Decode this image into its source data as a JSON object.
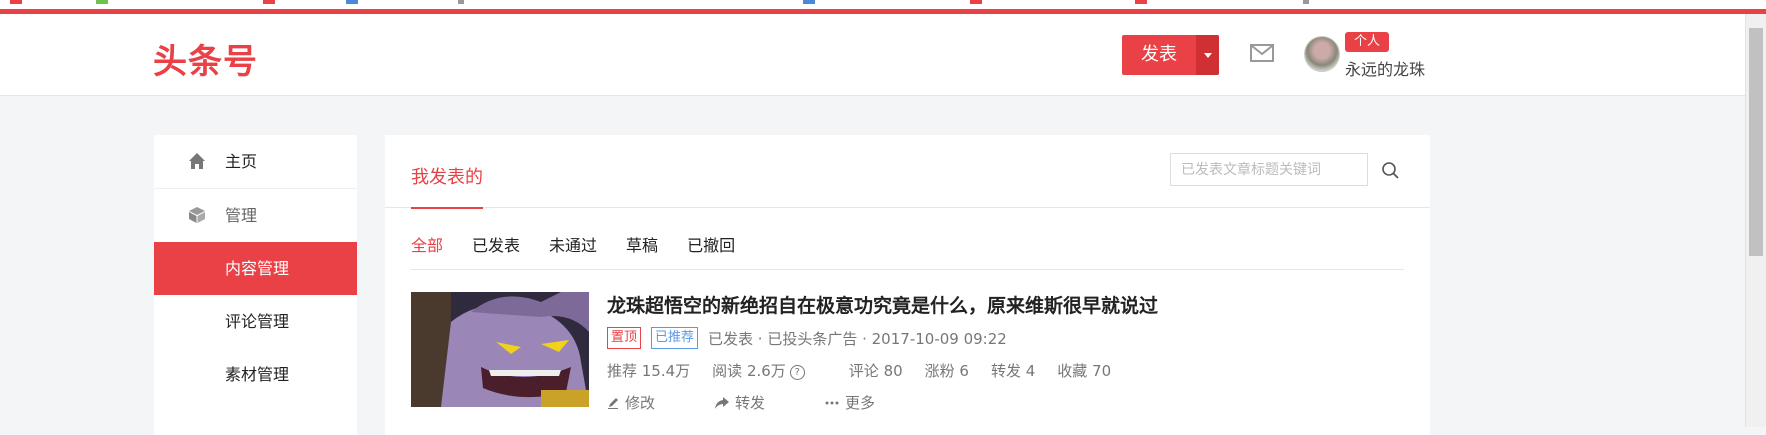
{
  "header": {
    "logo_text": "头条号",
    "publish_label": "发表",
    "badge_text": "个人",
    "username": "永远的龙珠"
  },
  "sidebar": {
    "items": [
      {
        "label": "主页",
        "icon": "home-icon"
      },
      {
        "label": "管理",
        "icon": "cube-icon"
      },
      {
        "label": "内容管理",
        "active": true
      },
      {
        "label": "评论管理"
      },
      {
        "label": "素材管理"
      }
    ]
  },
  "main": {
    "tab_label": "我发表的",
    "search_placeholder": "已发表文章标题关键词",
    "filters": [
      "全部",
      "已发表",
      "未通过",
      "草稿",
      "已撤回"
    ],
    "article": {
      "title": "龙珠超悟空的新绝招自在极意功究竟是什么，原来维斯很早就说过",
      "tag_pinned": "置顶",
      "tag_recommended": "已推荐",
      "status": "已发表 · 已投头条广告 · 2017-10-09 09:22",
      "stats": {
        "recommend": "推荐 15.4万",
        "read": "阅读 2.6万",
        "comment": "评论 80",
        "fans": "涨粉 6",
        "forward": "转发 4",
        "favorite": "收藏 70"
      },
      "actions": {
        "edit": "修改",
        "share": "转发",
        "more": "更多"
      }
    }
  },
  "colors": {
    "accent": "#e94145",
    "accent_dark": "#d02f33",
    "tag_blue": "#5a9be6"
  }
}
